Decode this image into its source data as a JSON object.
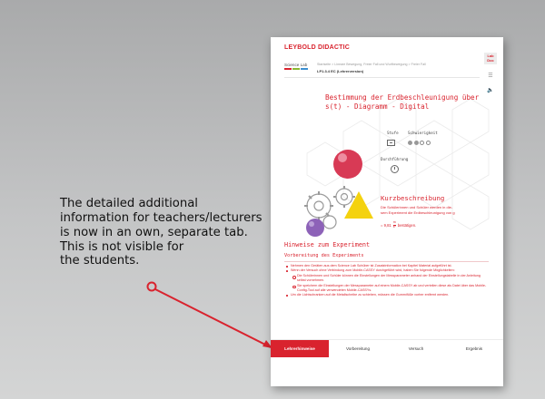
{
  "annotation": {
    "lines": [
      "The detailed additional",
      "information for teachers/lecturers",
      "is now in an own, separate tab.",
      "This is not visible for",
      "the students."
    ]
  },
  "colors": {
    "accent": "#d9232e",
    "background": "#bfc0c1",
    "connector": "#d9232e"
  },
  "app": {
    "brand": "LEYBOLD DIDACTIC",
    "logo_text": "Science Lab",
    "breadcrumb": "Startseite  >  Lineare Bewegung, Freier Fall und Wurfbewegung  >  Freier Fall",
    "experiment_code": "LP1.3.4 EC (Lehrerversion)",
    "rail": {
      "lab_doc": "Lab Doc",
      "list_icon": "list-icon",
      "sound_icon": "speaker-icon"
    }
  },
  "experiment": {
    "title_line1": "Bestimmung der Erdbeschleunigung über",
    "title_line2": "s(t) - Diagramm - Digital",
    "stufe_label": "Stufe",
    "schwierigkeit_label": "Schwierigkeit",
    "schwierigkeit_level": 2,
    "schwierigkeit_max": 4,
    "durchfuehrung_label": "Durchführung"
  },
  "kurzbeschreibung": {
    "heading": "Kurzbeschreibung",
    "text_line1": "Die Schülerinnen und Schüler werden in die-",
    "text_line2": "sem Experiment die Erdbeschleunigung von g",
    "text_line3": "bestätigen.",
    "formula_prefix": "= 9,81",
    "formula_num": "m",
    "formula_den": "s²"
  },
  "hinweise": {
    "heading": "Hinweise zum Experiment",
    "sub_heading": "Vorbereitung des Experiments",
    "items": [
      "Nehmen den Geräten aus dem Science Lab Schüber ist Zusatzinformation bei Kapitel Material aufgeführt ist.",
      "Wenn der Versuch ohne Verbindung zum Mobile-CASSY durchgeführt wird, haben Sie folgende Möglichkeiten:",
      "Die Schülerinnen und Schüler können die Einstellungen der Messparameter anhand der Einstellungstabelle in der Anleitung selbst vornehmen.",
      "Sie speichern die Einstellungen der Messparameter auf einem Mobile-CASSY ab und verteilen diese als Datei über das Mobile-Config-Tool auf alle verwendeten Mobile-CASSYs.",
      "Um die Lichtschranken auf die Metallscheibe zu schieben, müssen die Gummifüße vorher entfernt werden."
    ]
  },
  "tabs": [
    {
      "label": "Lehrerhinweise"
    },
    {
      "label": "Vorbereitung"
    },
    {
      "label": "Versuch"
    },
    {
      "label": "Ergebnis"
    }
  ],
  "active_tab": "Lehrerhinweise"
}
